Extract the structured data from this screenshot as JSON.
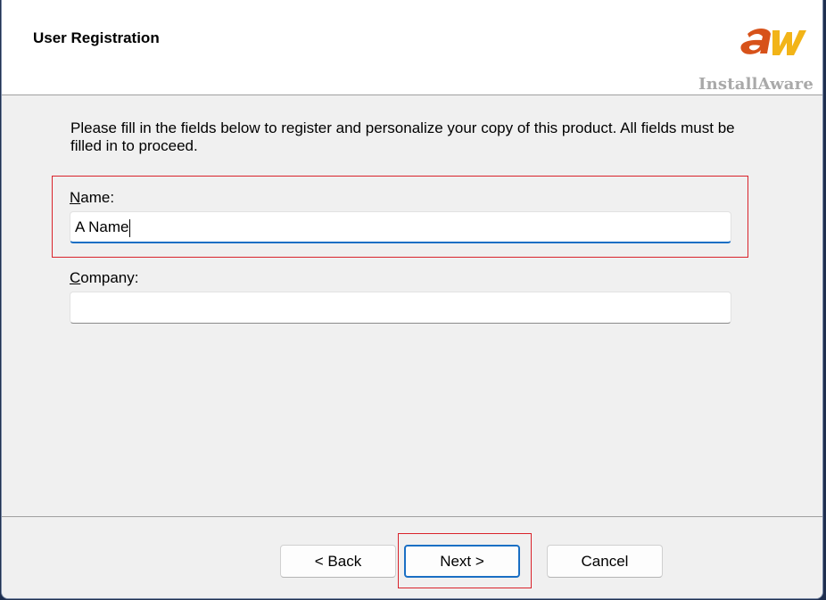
{
  "header": {
    "title": "User Registration",
    "logo_text": "InstallAware",
    "logo_icon": "installaware-logo-icon"
  },
  "intro_text": "Please fill in the fields below to register and personalize your copy of this product. All fields must be filled in to proceed.",
  "fields": {
    "name": {
      "label_mnemonic": "N",
      "label_rest": "ame:",
      "value": "A Name"
    },
    "company": {
      "label_mnemonic": "C",
      "label_rest": "ompany:",
      "value": ""
    }
  },
  "buttons": {
    "back": "< Back",
    "next": "Next >",
    "cancel": "Cancel"
  },
  "colors": {
    "highlight": "#d9232b",
    "focus_accent": "#1a6fc4",
    "logo_orange": "#d7521a",
    "logo_yellow": "#f2b418"
  }
}
